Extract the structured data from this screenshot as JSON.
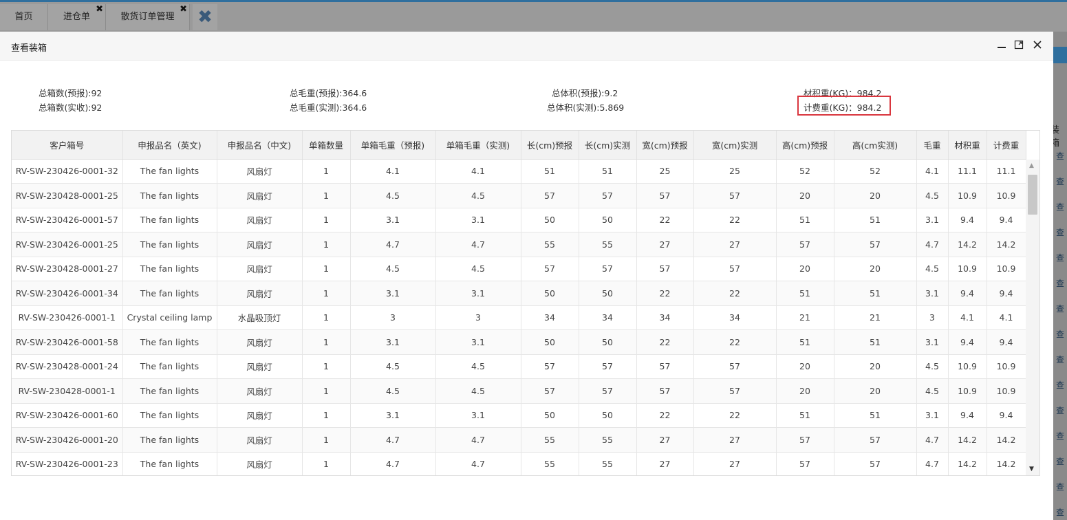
{
  "tabs": {
    "home": "首页",
    "inbound": "进仓单",
    "orders": "散货订单管理"
  },
  "modal": {
    "title": "查看装箱"
  },
  "summary": {
    "boxes_forecast": "总箱数(预报):92",
    "boxes_actual": "总箱数(实收):92",
    "gross_forecast": "总毛重(预报):364.6",
    "gross_actual": "总毛重(实测):364.6",
    "volume_forecast": "总体积(预报):9.2",
    "volume_actual": "总体积(实测):5.869",
    "vol_weight": "材积重(KG)：984.2",
    "charge_weight": "计费重(KG)：984.2"
  },
  "table": {
    "columns": [
      "客户箱号",
      "申报品名（英文)",
      "申报品名（中文)",
      "单箱数量",
      "单箱毛重（预报)",
      "单箱毛重（实测)",
      "长(cm)预报",
      "长(cm)实测",
      "宽(cm)预报",
      "宽(cm)实测",
      "高(cm)预报",
      "高(cm实测)",
      "毛重",
      "材积重",
      "计费重"
    ],
    "rows": [
      [
        "RV-SW-230426-0001-32",
        "The fan lights",
        "风扇灯",
        "1",
        "4.1",
        "4.1",
        "51",
        "51",
        "25",
        "25",
        "52",
        "52",
        "4.1",
        "11.1",
        "11.1"
      ],
      [
        "RV-SW-230428-0001-25",
        "The fan lights",
        "风扇灯",
        "1",
        "4.5",
        "4.5",
        "57",
        "57",
        "57",
        "57",
        "20",
        "20",
        "4.5",
        "10.9",
        "10.9"
      ],
      [
        "RV-SW-230426-0001-57",
        "The fan lights",
        "风扇灯",
        "1",
        "3.1",
        "3.1",
        "50",
        "50",
        "22",
        "22",
        "51",
        "51",
        "3.1",
        "9.4",
        "9.4"
      ],
      [
        "RV-SW-230426-0001-25",
        "The fan lights",
        "风扇灯",
        "1",
        "4.7",
        "4.7",
        "55",
        "55",
        "27",
        "27",
        "57",
        "57",
        "4.7",
        "14.2",
        "14.2"
      ],
      [
        "RV-SW-230428-0001-27",
        "The fan lights",
        "风扇灯",
        "1",
        "4.5",
        "4.5",
        "57",
        "57",
        "57",
        "57",
        "20",
        "20",
        "4.5",
        "10.9",
        "10.9"
      ],
      [
        "RV-SW-230426-0001-34",
        "The fan lights",
        "风扇灯",
        "1",
        "3.1",
        "3.1",
        "50",
        "50",
        "22",
        "22",
        "51",
        "51",
        "3.1",
        "9.4",
        "9.4"
      ],
      [
        "RV-SW-230426-0001-1",
        "Crystal ceiling lamp",
        "水晶吸顶灯",
        "1",
        "3",
        "3",
        "34",
        "34",
        "34",
        "34",
        "21",
        "21",
        "3",
        "4.1",
        "4.1"
      ],
      [
        "RV-SW-230426-0001-58",
        "The fan lights",
        "风扇灯",
        "1",
        "3.1",
        "3.1",
        "50",
        "50",
        "22",
        "22",
        "51",
        "51",
        "3.1",
        "9.4",
        "9.4"
      ],
      [
        "RV-SW-230428-0001-24",
        "The fan lights",
        "风扇灯",
        "1",
        "4.5",
        "4.5",
        "57",
        "57",
        "57",
        "57",
        "20",
        "20",
        "4.5",
        "10.9",
        "10.9"
      ],
      [
        "RV-SW-230428-0001-1",
        "The fan lights",
        "风扇灯",
        "1",
        "4.5",
        "4.5",
        "57",
        "57",
        "57",
        "57",
        "20",
        "20",
        "4.5",
        "10.9",
        "10.9"
      ],
      [
        "RV-SW-230426-0001-60",
        "The fan lights",
        "风扇灯",
        "1",
        "3.1",
        "3.1",
        "50",
        "50",
        "22",
        "22",
        "51",
        "51",
        "3.1",
        "9.4",
        "9.4"
      ],
      [
        "RV-SW-230426-0001-20",
        "The fan lights",
        "风扇灯",
        "1",
        "4.7",
        "4.7",
        "55",
        "55",
        "27",
        "27",
        "57",
        "57",
        "4.7",
        "14.2",
        "14.2"
      ],
      [
        "RV-SW-230426-0001-23",
        "The fan lights",
        "风扇灯",
        "1",
        "4.7",
        "4.7",
        "55",
        "55",
        "27",
        "27",
        "57",
        "57",
        "4.7",
        "14.2",
        "14.2"
      ]
    ]
  },
  "background": {
    "column_fragment": "装箱",
    "view_link": "查"
  },
  "colors": {
    "highlight_border": "#d9363e",
    "tab_accent": "#2f6f9e"
  }
}
